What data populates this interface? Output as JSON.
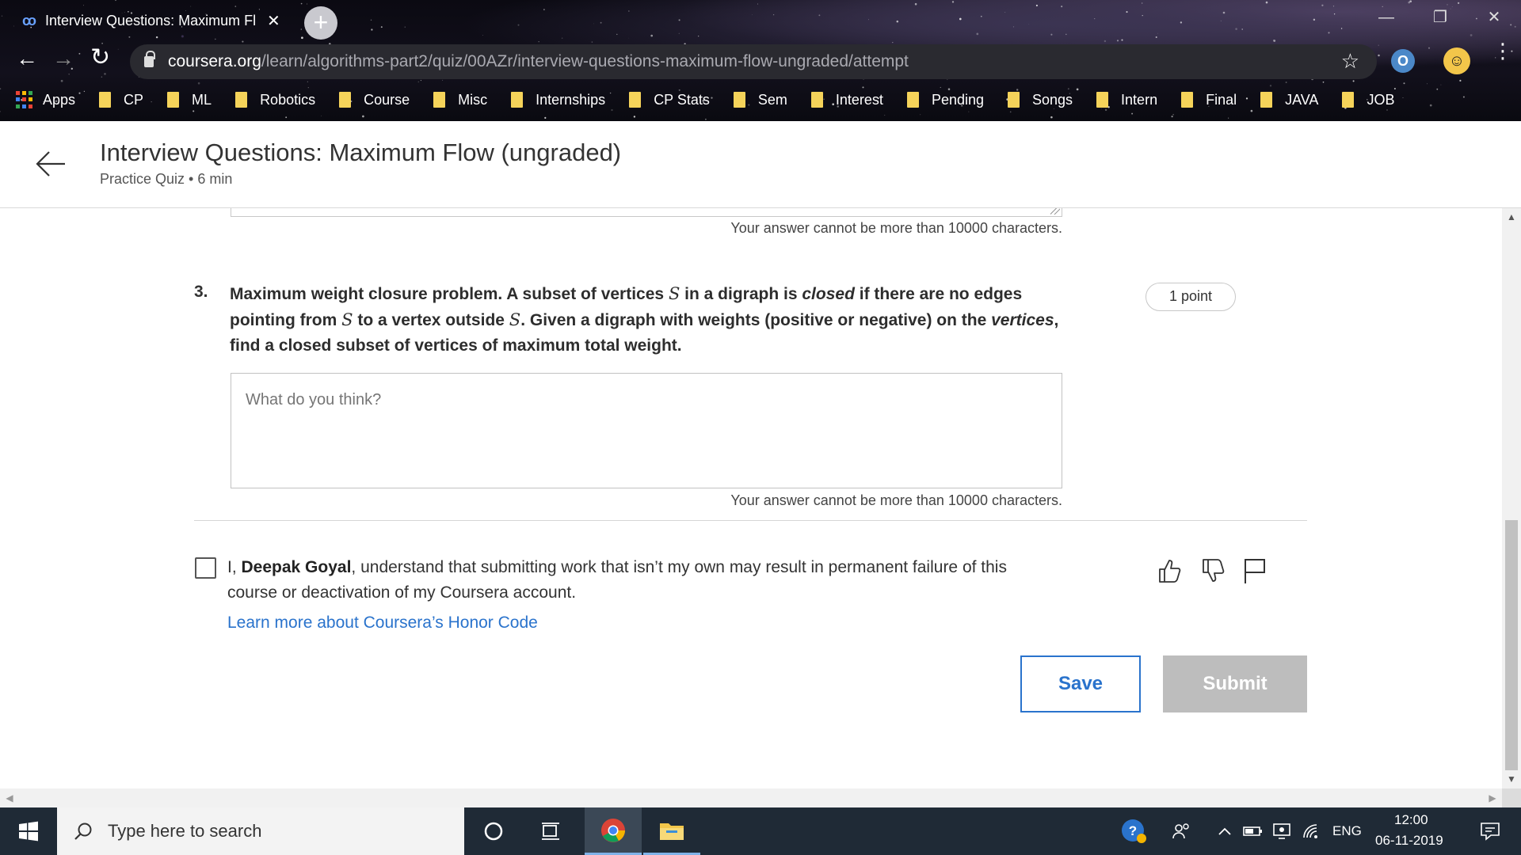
{
  "browser": {
    "tab_title": "Interview Questions: Maximum Fl",
    "tab_close": "✕",
    "new_tab": "+",
    "url_host": "coursera.org",
    "url_path": "/learn/algorithms-part2/quiz/00AZr/interview-questions-maximum-flow-ungraded/attempt",
    "bookmarks": [
      "Apps",
      "CP",
      "ML",
      "Robotics",
      "Course",
      "Misc",
      "Internships",
      "CP Stats",
      "Sem",
      "Interest",
      "Pending",
      "Songs",
      "Intern",
      "Final",
      "JAVA",
      "JOB"
    ]
  },
  "header": {
    "title": "Interview Questions: Maximum Flow (ungraded)",
    "subtitle": "Practice Quiz • 6 min"
  },
  "quiz": {
    "char_limit_text": "Your answer cannot be more than 10000 characters.",
    "question": {
      "number": "3.",
      "title": "Maximum weight closure problem.",
      "text_a": "A subset of vertices",
      "var_s": "S",
      "text_b": "in a digraph is",
      "closed": "closed",
      "text_c": "if there are no edges pointing from",
      "text_d": "to a vertex outside",
      "text_e": ". Given a digraph with weights (positive or negative) on the",
      "vertices": "vertices",
      "text_f": ", find a closed subset of vertices of maximum total weight.",
      "points": "1 point",
      "placeholder": "What do you think?"
    }
  },
  "honor": {
    "prefix": "I,",
    "name": "Deepak Goyal",
    "statement": ", understand that submitting work that isn’t my own may result in permanent failure of this course or deactivation of my Coursera account.",
    "link": "Learn more about Coursera’s Honor Code"
  },
  "actions": {
    "save": "Save",
    "submit": "Submit"
  },
  "taskbar": {
    "search_placeholder": "Type here to search",
    "language": "ENG",
    "time": "12:00",
    "date": "06-11-2019"
  },
  "colors": {
    "accent": "#2a73cc",
    "submit_disabled": "#bdbdbd",
    "bookmark_folder": "#f5d35a"
  }
}
